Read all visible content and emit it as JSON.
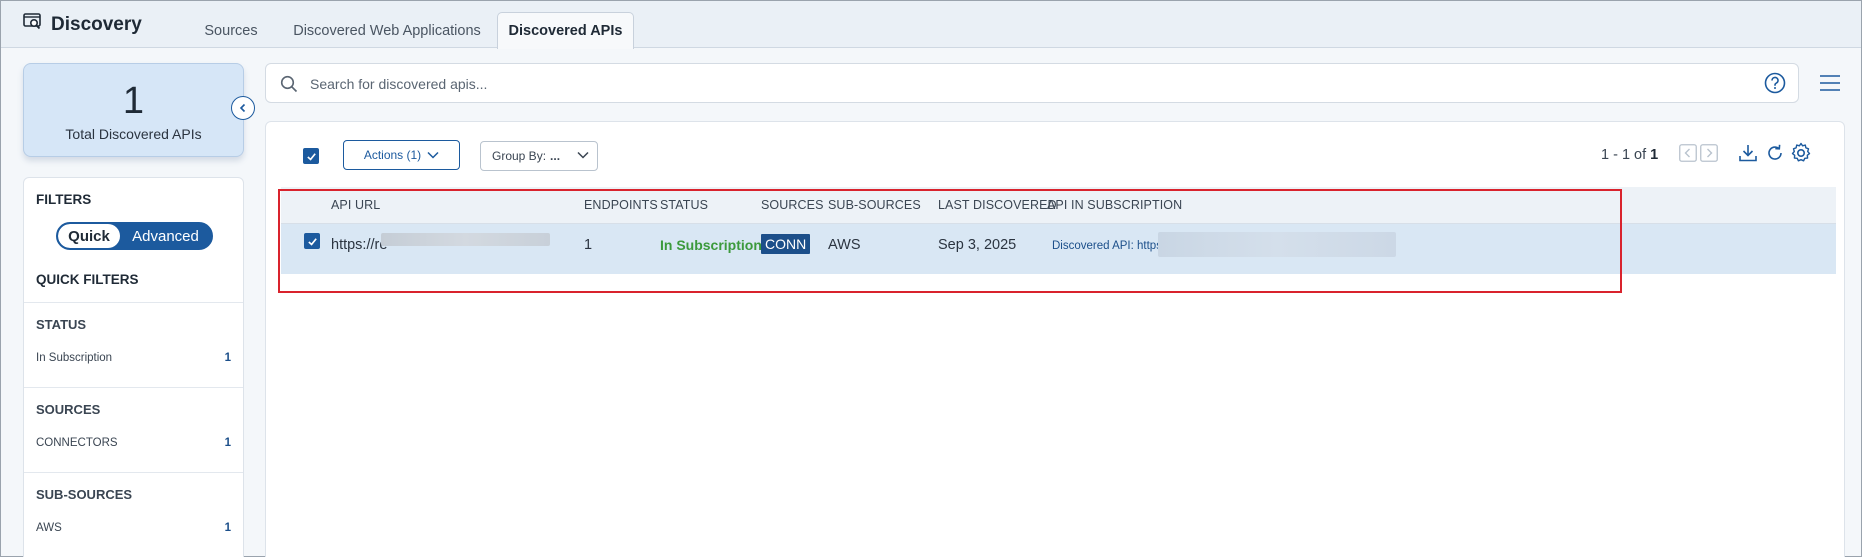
{
  "header": {
    "title": "Discovery",
    "tabs": [
      {
        "label": "Sources",
        "active": false
      },
      {
        "label": "Discovered Web Applications",
        "active": false
      },
      {
        "label": "Discovered APIs",
        "active": true
      }
    ]
  },
  "summary": {
    "total_count": "1",
    "total_label": "Total Discovered APIs"
  },
  "filters": {
    "title": "FILTERS",
    "toggle": {
      "quick": "Quick",
      "advanced": "Advanced",
      "selected": "Quick"
    },
    "quick_filters_title": "QUICK FILTERS",
    "sections": [
      {
        "title": "STATUS",
        "items": [
          {
            "label": "In Subscription",
            "count": "1"
          }
        ]
      },
      {
        "title": "SOURCES",
        "items": [
          {
            "label": "CONNECTORS",
            "count": "1"
          }
        ]
      },
      {
        "title": "SUB-SOURCES",
        "items": [
          {
            "label": "AWS",
            "count": "1"
          }
        ]
      }
    ]
  },
  "search": {
    "placeholder": "Search for discovered apis..."
  },
  "toolbar": {
    "actions_label": "Actions (1)",
    "group_by_label": "Group By:",
    "group_by_value": "...",
    "pager_text": "1 - 1 of",
    "pager_total": "1"
  },
  "table": {
    "columns": [
      "API URL",
      "ENDPOINTS",
      "STATUS",
      "SOURCES",
      "SUB-SOURCES",
      "LAST DISCOVERED",
      "API IN SUBSCRIPTION"
    ],
    "rows": [
      {
        "checked": true,
        "api_url": "https://re",
        "endpoints": "1",
        "status": "In Subscription",
        "sources": "CONN",
        "sub_sources": "AWS",
        "last_discovered": "Sep 3, 2025",
        "api_in_subscription": "Discovered API: https://"
      }
    ]
  },
  "colors": {
    "primary": "#1c5a9e",
    "status_green": "#3c9a3c",
    "highlight_red": "#d9232d",
    "row_selected": "#d9e7f4"
  }
}
